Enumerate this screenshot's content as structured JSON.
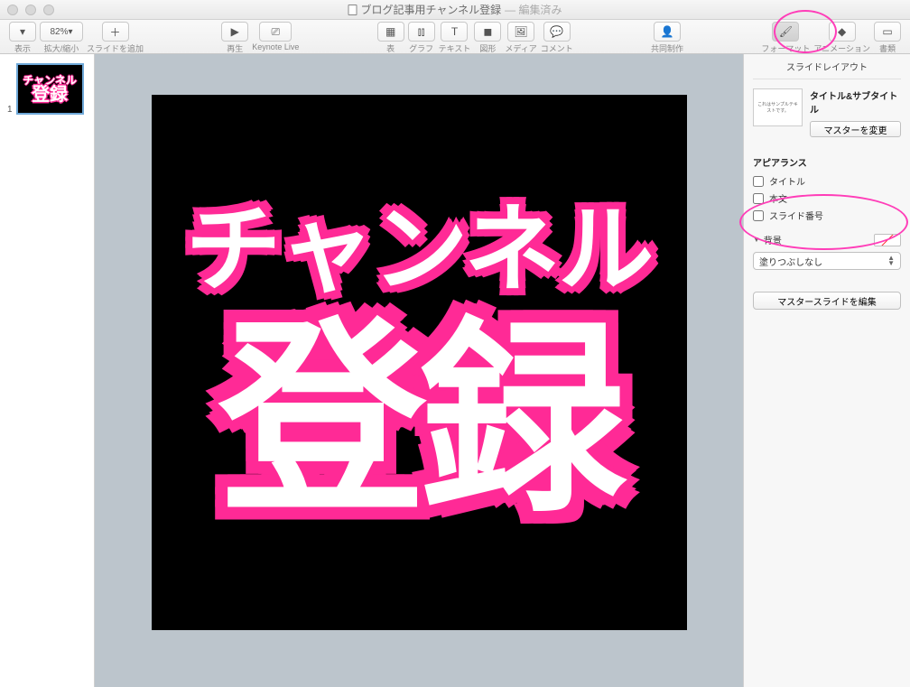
{
  "window": {
    "title": "ブログ記事用チャンネル登録",
    "edited": "— 編集済み"
  },
  "toolbar": {
    "view_label": "表示",
    "zoom_value": "82%",
    "zoom_label": "拡大/縮小",
    "add_slide_label": "スライドを追加",
    "play_label": "再生",
    "keynote_live_label": "Keynote Live",
    "table_label": "表",
    "chart_label": "グラフ",
    "text_label": "テキスト",
    "shape_label": "図形",
    "media_label": "メディア",
    "comment_label": "コメント",
    "collab_label": "共同制作",
    "format_label": "フォーマット",
    "animation_label": "アニメーション",
    "document_label": "書類"
  },
  "nav": {
    "slide_number": "1"
  },
  "slide": {
    "line1": "チャンネル",
    "line2": "登録"
  },
  "inspector": {
    "header": "スライドレイアウト",
    "master_thumb_text": "これはサンプルテキストです。",
    "layout_title": "タイトル&サブタイトル",
    "change_master": "マスターを変更",
    "appearance_label": "アピアランス",
    "cb_title": "タイトル",
    "cb_body": "本文",
    "cb_slide_num": "スライド番号",
    "background_label": "背景",
    "fill_type": "塗りつぶしなし",
    "edit_master": "マスタースライドを編集"
  }
}
